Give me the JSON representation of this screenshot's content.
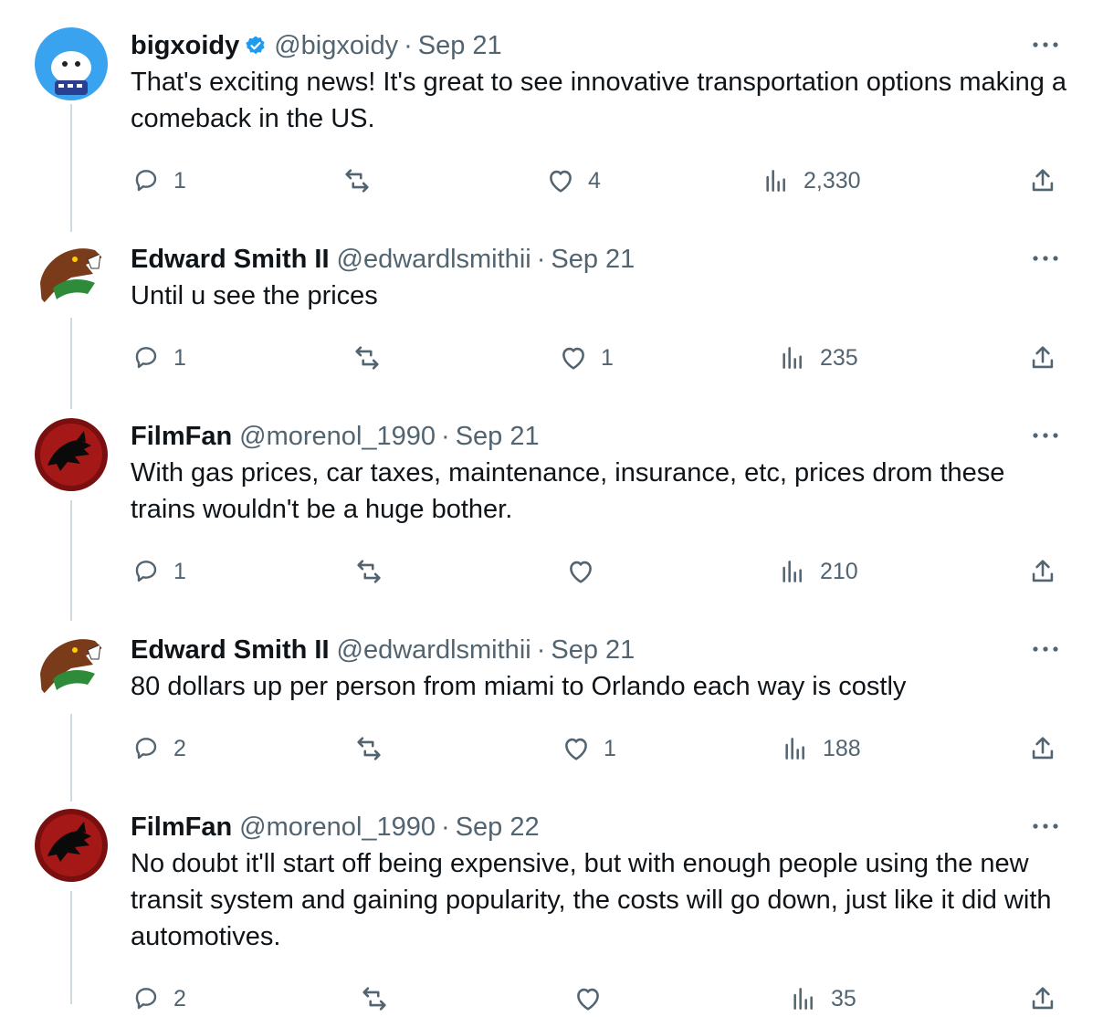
{
  "tweets": [
    {
      "name": "bigxoidy",
      "verified": true,
      "handle": "@bigxoidy",
      "separator": "·",
      "date": "Sep 21",
      "text": "That's exciting news! It's great to see innovative transportation options making a comeback in the US.",
      "replies": "1",
      "retweets": "",
      "likes": "4",
      "views": "2,330"
    },
    {
      "name": "Edward Smith II",
      "verified": false,
      "handle": "@edwardlsmithii",
      "separator": "·",
      "date": "Sep 21",
      "text": "Until u see the prices",
      "replies": "1",
      "retweets": "",
      "likes": "1",
      "views": "235"
    },
    {
      "name": "FilmFan",
      "verified": false,
      "handle": "@morenol_1990",
      "separator": "·",
      "date": "Sep 21",
      "text": "With gas prices, car taxes, maintenance, insurance, etc, prices drom these trains wouldn't be a huge bother.",
      "replies": "1",
      "retweets": "",
      "likes": "",
      "views": "210"
    },
    {
      "name": "Edward Smith II",
      "verified": false,
      "handle": "@edwardlsmithii",
      "separator": "·",
      "date": "Sep 21",
      "text": "80 dollars up per person from miami to Orlando each way is costly",
      "replies": "2",
      "retweets": "",
      "likes": "1",
      "views": "188"
    },
    {
      "name": "FilmFan",
      "verified": false,
      "handle": "@morenol_1990",
      "separator": "·",
      "date": "Sep 22",
      "text": "No doubt it'll start off being expensive, but with enough people using the new transit system and gaining popularity, the costs will go down, just like it did with automotives.",
      "replies": "2",
      "retweets": "",
      "likes": "",
      "views": "35"
    }
  ],
  "icons": {
    "reply": "reply-icon",
    "retweet": "retweet-icon",
    "like": "like-icon",
    "views": "views-icon",
    "share": "share-icon",
    "more": "more-icon",
    "verified": "verified-badge-icon"
  },
  "colors": {
    "text": "#0f1419",
    "secondary": "#536471",
    "verified": "#1d9bf0",
    "thread_line": "#cfd9de"
  }
}
